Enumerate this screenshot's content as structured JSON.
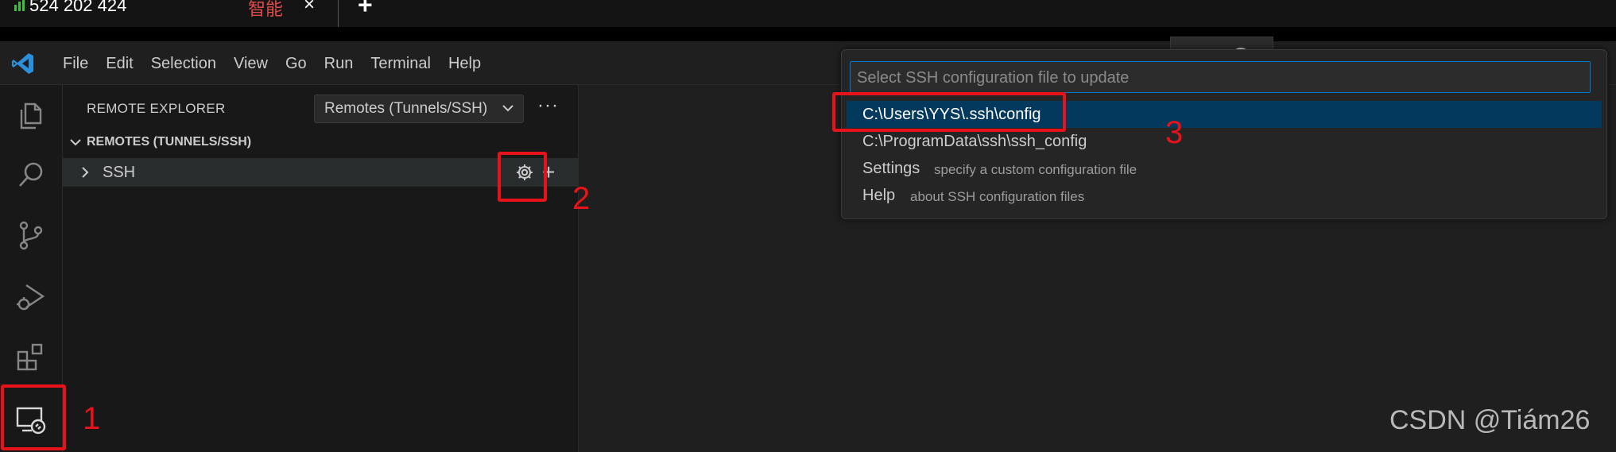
{
  "tabs": {
    "counter_text": "524 202 424",
    "active_label": "智能",
    "close_glyph": "×",
    "new_tab_glyph": "+"
  },
  "menu": {
    "items": [
      "File",
      "Edit",
      "Selection",
      "View",
      "Go",
      "Run",
      "Terminal",
      "Help"
    ]
  },
  "activity_bar": {
    "items": [
      "explorer-icon",
      "search-icon",
      "source-control-icon",
      "run-debug-icon",
      "extensions-icon",
      "remote-explorer-icon"
    ]
  },
  "sidebar": {
    "title": "REMOTE EXPLORER",
    "select_value": "Remotes (Tunnels/SSH)",
    "more_glyph": "···",
    "section_label": "REMOTES (TUNNELS/SSH)",
    "row_label": "SSH",
    "add_glyph": "+"
  },
  "quick_pick": {
    "placeholder": "Select SSH configuration file to update",
    "items": [
      {
        "label": "C:\\Users\\YYS\\.ssh\\config",
        "description": ""
      },
      {
        "label": "C:\\ProgramData\\ssh\\ssh_config",
        "description": ""
      },
      {
        "label": "Settings",
        "description": "specify a custom configuration file"
      },
      {
        "label": "Help",
        "description": "about SSH configuration files"
      }
    ]
  },
  "annotations": {
    "n1": "1",
    "n2": "2",
    "n3": "3"
  },
  "watermark": "CSDN @Tiám26",
  "colors": {
    "accent": "#0078d4",
    "selection": "#04395e",
    "annotation_red": "#e8131a"
  }
}
